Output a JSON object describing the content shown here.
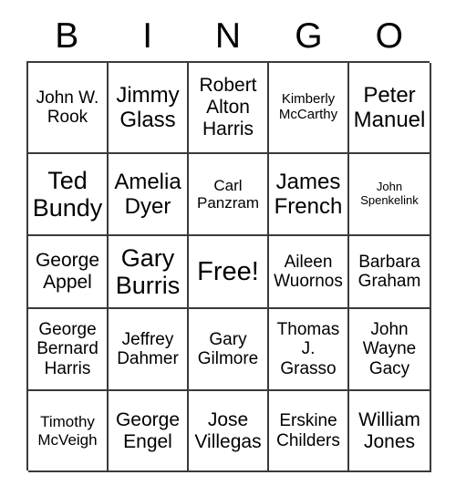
{
  "header": {
    "letters": [
      "B",
      "I",
      "N",
      "G",
      "O"
    ]
  },
  "grid": {
    "columns": 5,
    "rows": 5,
    "cells": [
      {
        "text": "John W. Rook",
        "size": "m"
      },
      {
        "text": "Jimmy Glass",
        "size": "xl"
      },
      {
        "text": "Robert Alton Harris",
        "size": "l"
      },
      {
        "text": "Kimberly McCarthy",
        "size": "xs"
      },
      {
        "text": "Peter Manuel",
        "size": "xl"
      },
      {
        "text": "Ted Bundy",
        "size": "xxl"
      },
      {
        "text": "Amelia Dyer",
        "size": "xl"
      },
      {
        "text": "Carl Panzram",
        "size": "s"
      },
      {
        "text": "James French",
        "size": "xl"
      },
      {
        "text": "John Spenkelink",
        "size": "xxs"
      },
      {
        "text": "George Appel",
        "size": "l"
      },
      {
        "text": "Gary Burris",
        "size": "xxl"
      },
      {
        "text": "Free!",
        "size": "free"
      },
      {
        "text": "Aileen Wuornos",
        "size": "m"
      },
      {
        "text": "Barbara Graham",
        "size": "m"
      },
      {
        "text": "George Bernard Harris",
        "size": "m"
      },
      {
        "text": "Jeffrey Dahmer",
        "size": "m"
      },
      {
        "text": "Gary Gilmore",
        "size": "m"
      },
      {
        "text": "Thomas J. Grasso",
        "size": "m"
      },
      {
        "text": "John Wayne Gacy",
        "size": "m"
      },
      {
        "text": "Timothy McVeigh",
        "size": "s"
      },
      {
        "text": "George Engel",
        "size": "l"
      },
      {
        "text": "Jose Villegas",
        "size": "l"
      },
      {
        "text": "Erskine Childers",
        "size": "m"
      },
      {
        "text": "William Jones",
        "size": "l"
      }
    ]
  },
  "colors": {
    "background": "#ffffff",
    "text": "#000000",
    "grid_line": "#3a3a3a"
  }
}
